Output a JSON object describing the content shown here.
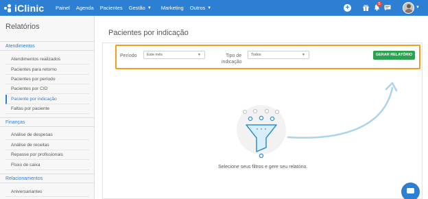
{
  "app": {
    "name": "iClinic"
  },
  "nav": {
    "items": [
      {
        "label": "Painel"
      },
      {
        "label": "Agenda"
      },
      {
        "label": "Pacientes"
      },
      {
        "label": "Gestão",
        "has_dropdown": true
      },
      {
        "label": "Marketing"
      },
      {
        "label": "Outros",
        "has_dropdown": true
      }
    ],
    "notification_count": "5"
  },
  "sidebar": {
    "title": "Relatórios",
    "sections": [
      {
        "label": "Atendimentos",
        "items": [
          "Atendimentos realizados",
          "Pacientes para retorno",
          "Pacientes por período",
          "Pacientes por CID",
          "Paciente por indicação",
          "Faltas por paciente"
        ],
        "active_index": 4
      },
      {
        "label": "Finanças",
        "items": [
          "Análise de despesas",
          "Análise de receitas",
          "Repasse por profissionais",
          "Fluxo de caixa"
        ]
      },
      {
        "label": "Relacionamentos",
        "items": [
          "Aniversariantes"
        ]
      }
    ]
  },
  "main": {
    "title": "Pacientes por indicação",
    "filters": {
      "period_label": "Período",
      "period_value": "Este mês",
      "type_label_line1": "Tipo de",
      "type_label_line2": "indicação",
      "type_value": "Todos",
      "generate_label": "GERAR RELATÓRIO"
    },
    "empty_message": "Selecione seus filtros e gere seu relatório."
  },
  "colors": {
    "brand": "#2d7fd3",
    "highlight": "#f29d1f",
    "success": "#2aa24f"
  }
}
